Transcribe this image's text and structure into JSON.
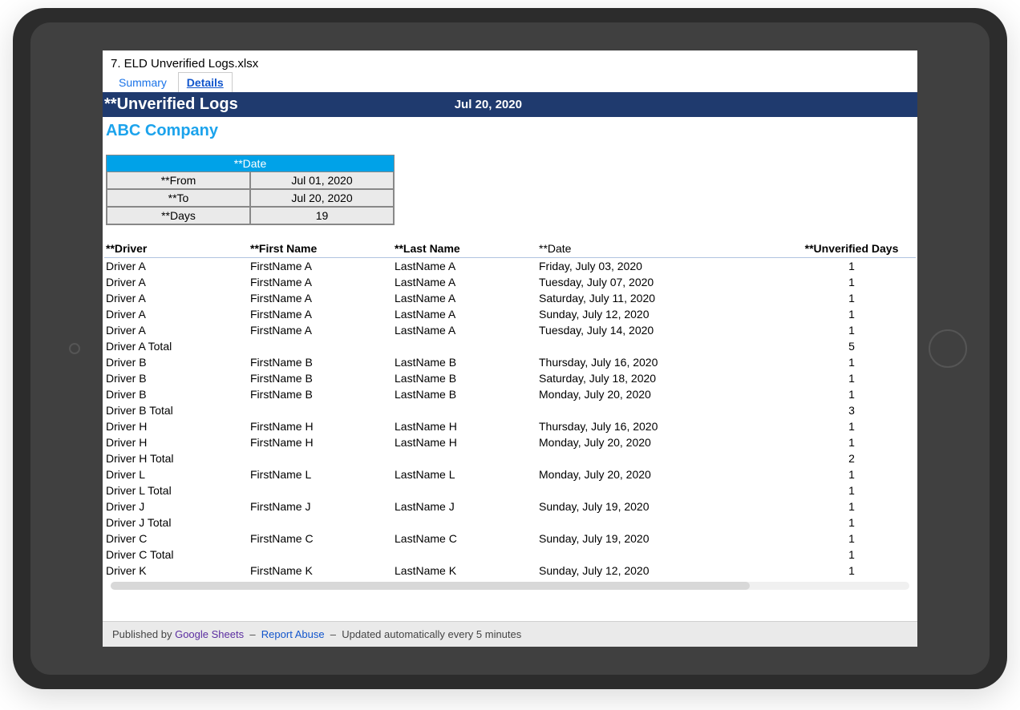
{
  "doc": {
    "title": "7. ELD Unverified Logs.xlsx",
    "tabs": [
      "Summary",
      "Details"
    ],
    "active_tab": "Details"
  },
  "header": {
    "title": "**Unverified Logs",
    "date": "Jul 20, 2020",
    "company": "ABC Company"
  },
  "date_box": {
    "header": "**Date",
    "rows": [
      {
        "label": "**From",
        "value": "Jul 01, 2020"
      },
      {
        "label": "**To",
        "value": "Jul 20, 2020"
      },
      {
        "label": "**Days",
        "value": "19"
      }
    ]
  },
  "columns": {
    "driver": "**Driver",
    "first": "**First Name",
    "last": "**Last Name",
    "date": "**Date",
    "days": "**Unverified Days"
  },
  "rows": [
    {
      "driver": "Driver A",
      "first": "FirstName A",
      "last": "LastName A",
      "date": "Friday, July 03, 2020",
      "days": "1"
    },
    {
      "driver": "Driver A",
      "first": "FirstName A",
      "last": "LastName A",
      "date": "Tuesday, July 07, 2020",
      "days": "1"
    },
    {
      "driver": "Driver A",
      "first": "FirstName A",
      "last": "LastName A",
      "date": "Saturday, July 11, 2020",
      "days": "1"
    },
    {
      "driver": "Driver A",
      "first": "FirstName A",
      "last": "LastName A",
      "date": "Sunday, July 12, 2020",
      "days": "1"
    },
    {
      "driver": "Driver A",
      "first": "FirstName A",
      "last": "LastName A",
      "date": "Tuesday, July 14, 2020",
      "days": "1"
    },
    {
      "driver": "Driver A Total",
      "first": "",
      "last": "",
      "date": "",
      "days": "5"
    },
    {
      "driver": "Driver B",
      "first": "FirstName B",
      "last": "LastName B",
      "date": "Thursday, July 16, 2020",
      "days": "1"
    },
    {
      "driver": "Driver B",
      "first": "FirstName B",
      "last": "LastName B",
      "date": "Saturday, July 18, 2020",
      "days": "1"
    },
    {
      "driver": "Driver B",
      "first": "FirstName B",
      "last": "LastName B",
      "date": "Monday, July 20, 2020",
      "days": "1"
    },
    {
      "driver": "Driver B Total",
      "first": "",
      "last": "",
      "date": "",
      "days": "3"
    },
    {
      "driver": "Driver H",
      "first": "FirstName H",
      "last": "LastName H",
      "date": "Thursday, July 16, 2020",
      "days": "1"
    },
    {
      "driver": "Driver H",
      "first": "FirstName H",
      "last": "LastName H",
      "date": "Monday, July 20, 2020",
      "days": "1"
    },
    {
      "driver": "Driver H Total",
      "first": "",
      "last": "",
      "date": "",
      "days": "2"
    },
    {
      "driver": "Driver L",
      "first": "FirstName L",
      "last": "LastName L",
      "date": "Monday, July 20, 2020",
      "days": "1"
    },
    {
      "driver": "Driver L Total",
      "first": "",
      "last": "",
      "date": "",
      "days": "1"
    },
    {
      "driver": "Driver J",
      "first": "FirstName J",
      "last": "LastName J",
      "date": "Sunday, July 19, 2020",
      "days": "1"
    },
    {
      "driver": "Driver J Total",
      "first": "",
      "last": "",
      "date": "",
      "days": "1"
    },
    {
      "driver": "Driver C",
      "first": "FirstName C",
      "last": "LastName C",
      "date": "Sunday, July 19, 2020",
      "days": "1"
    },
    {
      "driver": "Driver C Total",
      "first": "",
      "last": "",
      "date": "",
      "days": "1"
    },
    {
      "driver": "Driver K",
      "first": "FirstName K",
      "last": "LastName K",
      "date": "Sunday, July 12, 2020",
      "days": "1"
    }
  ],
  "footer": {
    "published_by": "Published by",
    "sheets": "Google Sheets",
    "report_abuse": "Report Abuse",
    "updated": "Updated automatically every 5 minutes"
  }
}
